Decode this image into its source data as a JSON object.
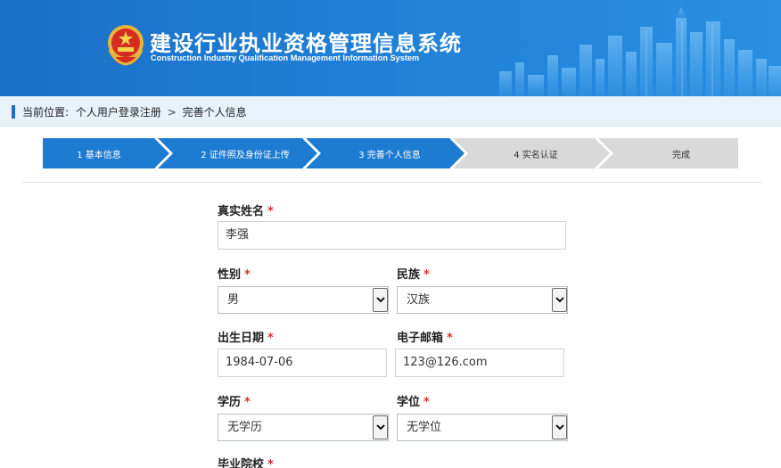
{
  "header": {
    "title_cn": "建设行业执业资格管理信息系统",
    "title_en": "Construction Industry Qualification Management Information System"
  },
  "breadcrumb": {
    "prefix": "当前位置:",
    "items": [
      "个人用户登录注册",
      "完善个人信息"
    ],
    "separator": ">"
  },
  "steps": [
    {
      "label": "1 基本信息",
      "state": "done"
    },
    {
      "label": "2 证件照及身份证上传",
      "state": "done"
    },
    {
      "label": "3 完善个人信息",
      "state": "current"
    },
    {
      "label": "4 实名认证",
      "state": "pending"
    },
    {
      "label": "完成",
      "state": "pending"
    }
  ],
  "form": {
    "required_mark": "*",
    "real_name": {
      "label": "真实姓名",
      "value": "李强"
    },
    "gender": {
      "label": "性别",
      "value": "男"
    },
    "ethnicity": {
      "label": "民族",
      "value": "汉族"
    },
    "birth_date": {
      "label": "出生日期",
      "value": "1984-07-06"
    },
    "email": {
      "label": "电子邮箱",
      "value": "123@126.com"
    },
    "education": {
      "label": "学历",
      "value": "无学历"
    },
    "degree": {
      "label": "学位",
      "value": "无学位"
    },
    "school": {
      "label": "毕业院校"
    }
  },
  "colors": {
    "header_blue": "#1f7fd6",
    "step_active": "#1e7bd2",
    "step_inactive": "#d9d9d9",
    "required": "#d9302b"
  }
}
